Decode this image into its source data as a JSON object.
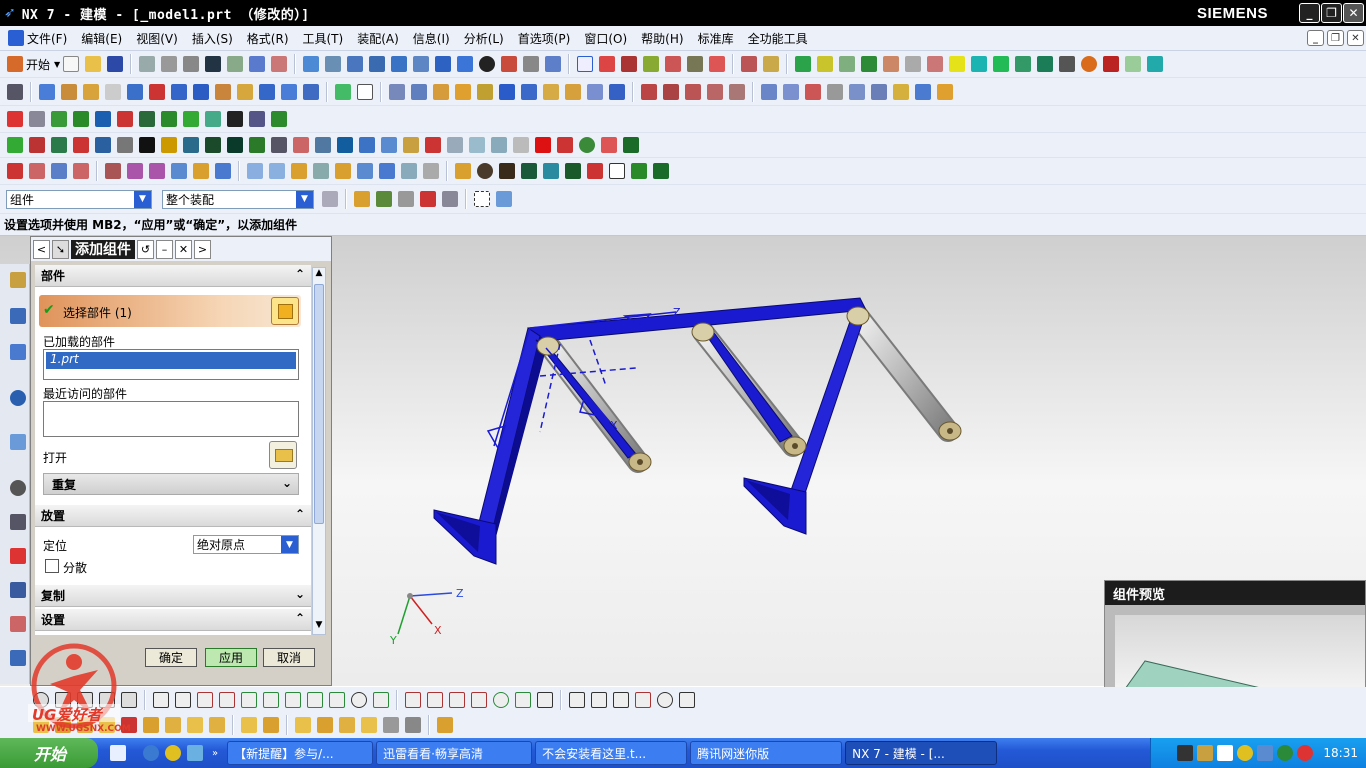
{
  "window": {
    "title": "NX 7 - 建模 - [_model1.prt （修改的）]",
    "brand": "SIEMENS",
    "controls": [
      "_",
      "❐",
      "✕"
    ]
  },
  "menu": [
    "文件(F)",
    "编辑(E)",
    "视图(V)",
    "插入(S)",
    "格式(R)",
    "工具(T)",
    "装配(A)",
    "信息(I)",
    "分析(L)",
    "首选项(P)",
    "窗口(O)",
    "帮助(H)",
    "标准库",
    "全功能工具"
  ],
  "toolbar": {
    "start_label": "开始",
    "filter_value": "组件",
    "scope_value": "整个装配"
  },
  "cue_line": "设置选项并使用 MB2，“应用”或“确定”，以添加组件",
  "dialog": {
    "title": "添加组件",
    "nav_icons": [
      "<",
      ">"
    ],
    "section_part": "部件",
    "select_part": "选择部件 (1)",
    "loaded_label": "已加载的部件",
    "loaded_item": "1.prt",
    "recent_label": "最近访问的部件",
    "open_label": "打开",
    "repeat_label": "重复",
    "section_place": "放置",
    "position_label": "定位",
    "position_value": "绝对原点",
    "scatter_label": "分散",
    "section_copy": "复制",
    "section_settings": "设置",
    "ok": "确定",
    "apply": "应用",
    "cancel": "取消"
  },
  "model_labels": {
    "z": "Z",
    "x": "X",
    "triad_z": "Z",
    "triad_x": "X",
    "triad_y": "Y"
  },
  "preview": {
    "title": "组件预览"
  },
  "watermark": {
    "brand": "UG爱好者",
    "url": "WWW.UGSNX.COM"
  },
  "taskbar": {
    "start": "开始",
    "tasks": [
      "【新提醒】参与/...",
      "迅雷看看·畅享高清",
      "不会安装看这里.t...",
      "腾讯网迷你版",
      "NX 7 - 建模 - [..."
    ],
    "clock": "18:31"
  },
  "colors": {
    "accent": "#2a5fd3",
    "frame": "#1a1acf",
    "roller": "#c8c8c8"
  }
}
